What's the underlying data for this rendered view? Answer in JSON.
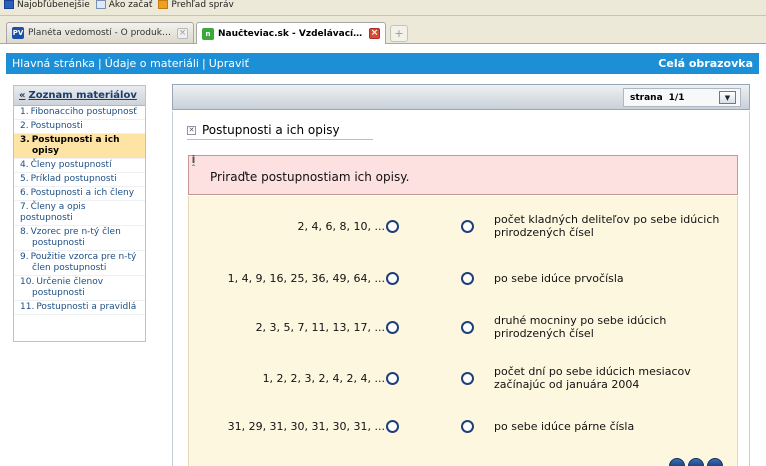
{
  "bookmarks": [
    {
      "label": "Najobľúbenejšie",
      "icon": "page-icon"
    },
    {
      "label": "Ako začať",
      "icon": "page-icon"
    },
    {
      "label": "Prehľad správ",
      "icon": "rss-icon"
    }
  ],
  "tabs": [
    {
      "label": "Planéta vedomostí - O produkte - Inštr...",
      "favicon": "PV",
      "active": false
    },
    {
      "label": "Naučteviac.sk - Vzdelávací portál...",
      "favicon": "n",
      "active": true
    }
  ],
  "newtab_label": "+",
  "nav": {
    "home": "Hlavná stránka",
    "material": "Údaje o materiáli",
    "edit": "Upraviť",
    "fullscreen": "Celá obrazovka"
  },
  "sidebar": {
    "back": "«",
    "title": "Zoznam materiálov",
    "items": [
      {
        "num": "1.",
        "label": "Fibonacciho postupnosť",
        "sub": ""
      },
      {
        "num": "2.",
        "label": "Postupnosti",
        "sub": ""
      },
      {
        "num": "3.",
        "label": "Postupnosti a ich",
        "sub": "opisy",
        "active": true
      },
      {
        "num": "4.",
        "label": "Členy postupností",
        "sub": ""
      },
      {
        "num": "5.",
        "label": "Príklad postupnosti",
        "sub": ""
      },
      {
        "num": "6.",
        "label": "Postupnosti a ich členy",
        "sub": ""
      },
      {
        "num": "7.",
        "label": "Členy a opis postupnosti",
        "sub": ""
      },
      {
        "num": "8.",
        "label": "Vzorec pre  n-tý člen",
        "sub": "postupnosti"
      },
      {
        "num": "9.",
        "label": "Použitie vzorca pre  n-tý",
        "sub": "člen postupnosti"
      },
      {
        "num": "10.",
        "label": "Určenie členov",
        "sub": "postupnosti"
      },
      {
        "num": "11.",
        "label": "Postupnosti a pravidlá",
        "sub": ""
      }
    ]
  },
  "pager": {
    "label": "strana",
    "value": "1/1",
    "dropdown_icon": "chevron-down-icon"
  },
  "content": {
    "title": "Postupnosti a ich opisy",
    "info_icon": "i",
    "task": "Priraďte postupnostiam ich opisy.",
    "sequences": [
      "2, 4, 6, 8, 10, ...",
      "1, 4, 9, 16, 25, 36, 49, 64, ...",
      "2, 3, 5, 7, 11, 13, 17, ...",
      "1, 2, 2, 3, 2, 4, 2, 4, ...",
      "31, 29, 31, 30, 31, 30, 31, ..."
    ],
    "descriptions": [
      "počet kladných deliteľov po sebe idúcich prirodzených čísel",
      "po sebe idúce prvočísla",
      "druhé mocniny po sebe idúcich prirodzených čísel",
      "počet dní po sebe idúcich mesiacov začínajúc od januára 2004",
      "po sebe idúce párne čísla"
    ]
  },
  "colors": {
    "navbar": "#1c8fd6",
    "active_item": "#fde3a4",
    "task_bg": "#fde0e0",
    "work_bg": "#fef7e0"
  }
}
